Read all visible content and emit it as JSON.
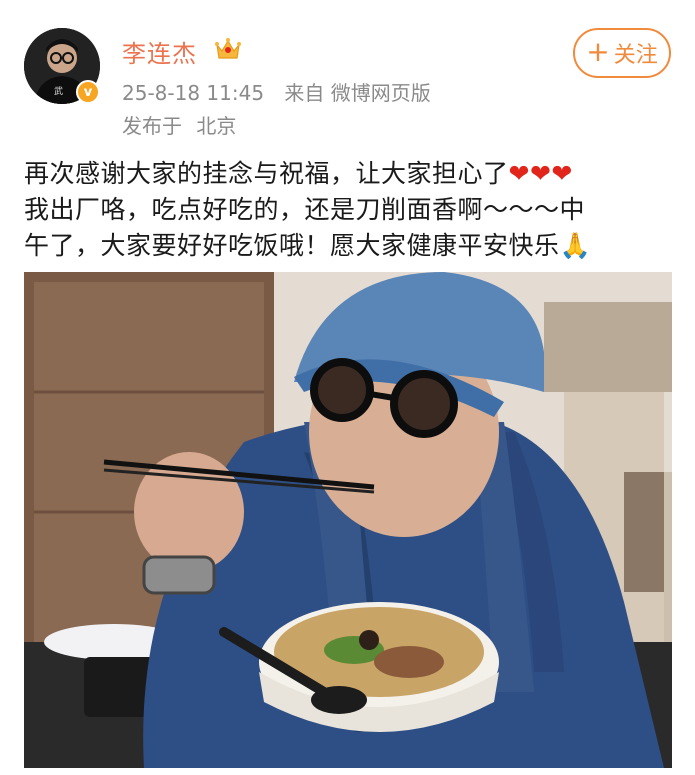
{
  "user": {
    "name": "李连杰",
    "avatar_icon": "avatar-icon",
    "verified_icon": "verified-v-badge",
    "membership_icon": "crown-icon"
  },
  "meta": {
    "time": "25-8-18 11:45",
    "source": "来自 微博网页版",
    "location_label": "发布于",
    "location": "北京"
  },
  "follow_button": {
    "plus": "+",
    "label": "关注"
  },
  "post": {
    "line1": "再次感谢大家的挂念与祝福，让大家担心了",
    "hearts": "❤❤❤",
    "line2": "我出厂咯，吃点好吃的，还是刀削面香啊～～～中",
    "line3": "午了，大家要好好吃饭哦！愿大家健康平安快乐",
    "emoji_pray": "🙏"
  },
  "photo": {
    "watermark": ""
  },
  "colors": {
    "accent": "#eb7350",
    "follow": "#f08a3c",
    "meta": "#8a8a8a",
    "heart": "#e1251b"
  }
}
